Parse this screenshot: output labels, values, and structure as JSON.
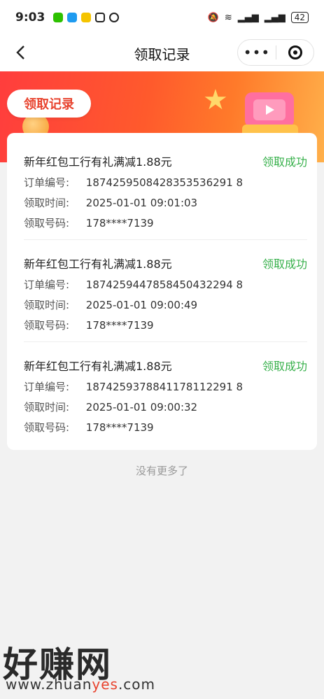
{
  "status_bar": {
    "time": "9:03",
    "battery": "42"
  },
  "nav": {
    "title": "领取记录",
    "more_label": "•••"
  },
  "banner": {
    "tag": "领取记录"
  },
  "records": [
    {
      "title": "新年红包工行有礼满减1.88元",
      "status": "领取成功",
      "order_label": "订单编号:",
      "order_no": "1874259508428353536291 8",
      "time_label": "领取时间:",
      "time": "2025-01-01 09:01:03",
      "phone_label": "领取号码:",
      "phone": "178****7139"
    },
    {
      "title": "新年红包工行有礼满减1.88元",
      "status": "领取成功",
      "order_label": "订单编号:",
      "order_no": "1874259447858450432294 8",
      "time_label": "领取时间:",
      "time": "2025-01-01 09:00:49",
      "phone_label": "领取号码:",
      "phone": "178****7139"
    },
    {
      "title": "新年红包工行有礼满减1.88元",
      "status": "领取成功",
      "order_label": "订单编号:",
      "order_no": "1874259378841178112291 8",
      "time_label": "领取时间:",
      "time": "2025-01-01 09:00:32",
      "phone_label": "领取号码:",
      "phone": "178****7139"
    }
  ],
  "footer": {
    "no_more": "没有更多了"
  },
  "watermark": {
    "brand": "好赚网",
    "url_prefix": "www.zhuan",
    "url_highlight": "yes",
    "url_suffix": ".com"
  },
  "colors": {
    "success": "#36b04a",
    "brand_red": "#e8432e"
  }
}
